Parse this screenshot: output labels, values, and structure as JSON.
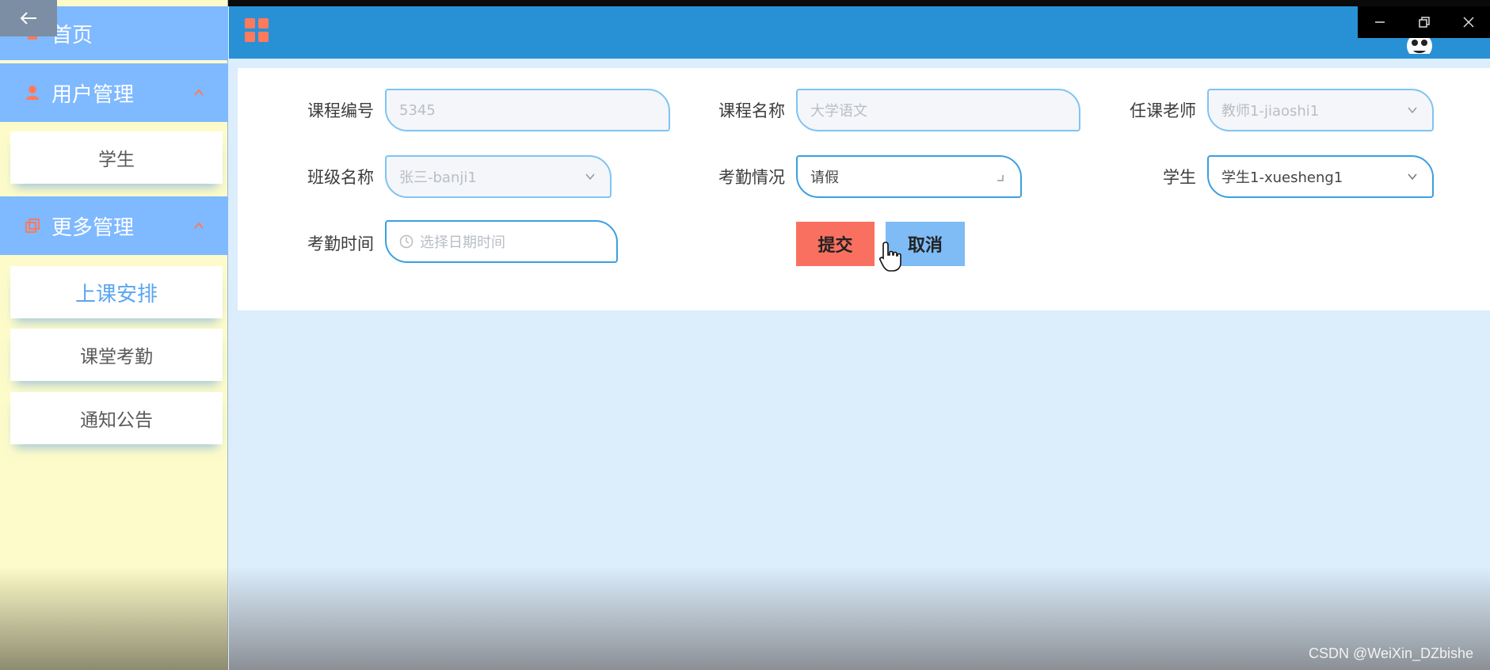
{
  "sidebar": {
    "home_label": "首页",
    "groups": [
      {
        "label": "用户管理",
        "items": [
          "学生"
        ]
      },
      {
        "label": "更多管理",
        "items": [
          "上课安排",
          "课堂考勤",
          "通知公告"
        ]
      }
    ],
    "active_item": "上课安排"
  },
  "form": {
    "course_no_label": "课程编号",
    "course_no_value": "5345",
    "course_name_label": "课程名称",
    "course_name_placeholder": "大学语文",
    "teacher_label": "任课老师",
    "teacher_value": "教师1-jiaoshi1",
    "class_label": "班级名称",
    "class_value": "张三-banji1",
    "attendance_label": "考勤情况",
    "attendance_value": "请假",
    "student_label": "学生",
    "student_value": "学生1-xuesheng1",
    "time_label": "考勤时间",
    "time_placeholder": "选择日期时间"
  },
  "buttons": {
    "submit": "提交",
    "cancel": "取消"
  },
  "colors": {
    "header": "#2891d6",
    "sidebar_group": "#7fb9ff",
    "sidebar_bg": "#fdfbc9",
    "submit": "#f97060",
    "cancel": "#7fbbf4",
    "active_item": "#5aa6f0"
  },
  "icons": {
    "header": "grid-menu-icon",
    "home": "home-icon",
    "users": "user-icon",
    "more": "copy-icon"
  },
  "watermark": "CSDN @WeiXin_DZbishe"
}
